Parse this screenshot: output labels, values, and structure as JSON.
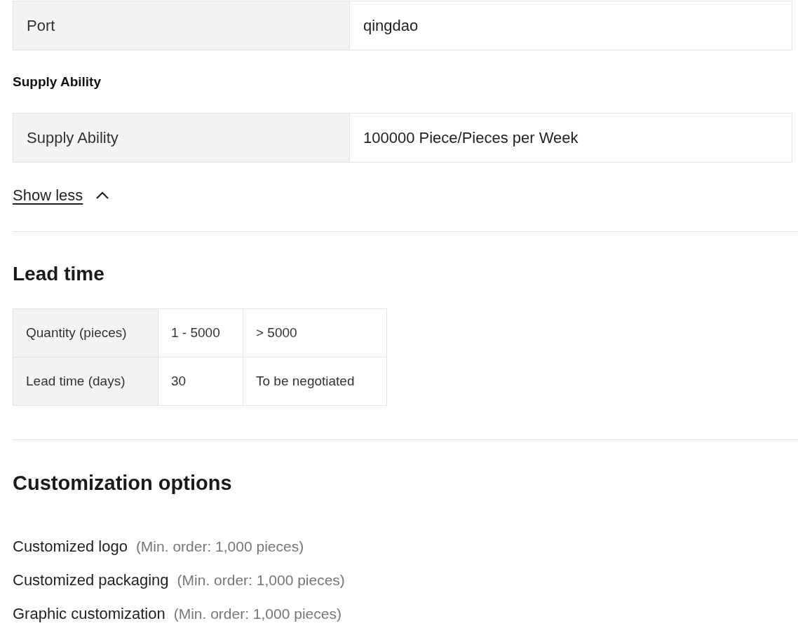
{
  "attributes": [
    {
      "label": "Port",
      "value": "qingdao"
    }
  ],
  "supply": {
    "heading": "Supply Ability",
    "rows": [
      {
        "label": "Supply Ability",
        "value": "100000 Piece/Pieces per Week"
      }
    ]
  },
  "toggle": {
    "label": "Show less",
    "expanded": true
  },
  "lead_time": {
    "heading": "Lead time",
    "rows": [
      [
        "Quantity (pieces)",
        "1 - 5000",
        "> 5000"
      ],
      [
        "Lead time (days)",
        "30",
        "To be negotiated"
      ]
    ]
  },
  "customization": {
    "heading": "Customization options",
    "items": [
      {
        "name": "Customized logo",
        "note": "(Min. order: 1,000 pieces)"
      },
      {
        "name": "Customized packaging",
        "note": "(Min. order: 1,000 pieces)"
      },
      {
        "name": "Graphic customization",
        "note": "(Min. order: 1,000 pieces)"
      }
    ]
  }
}
